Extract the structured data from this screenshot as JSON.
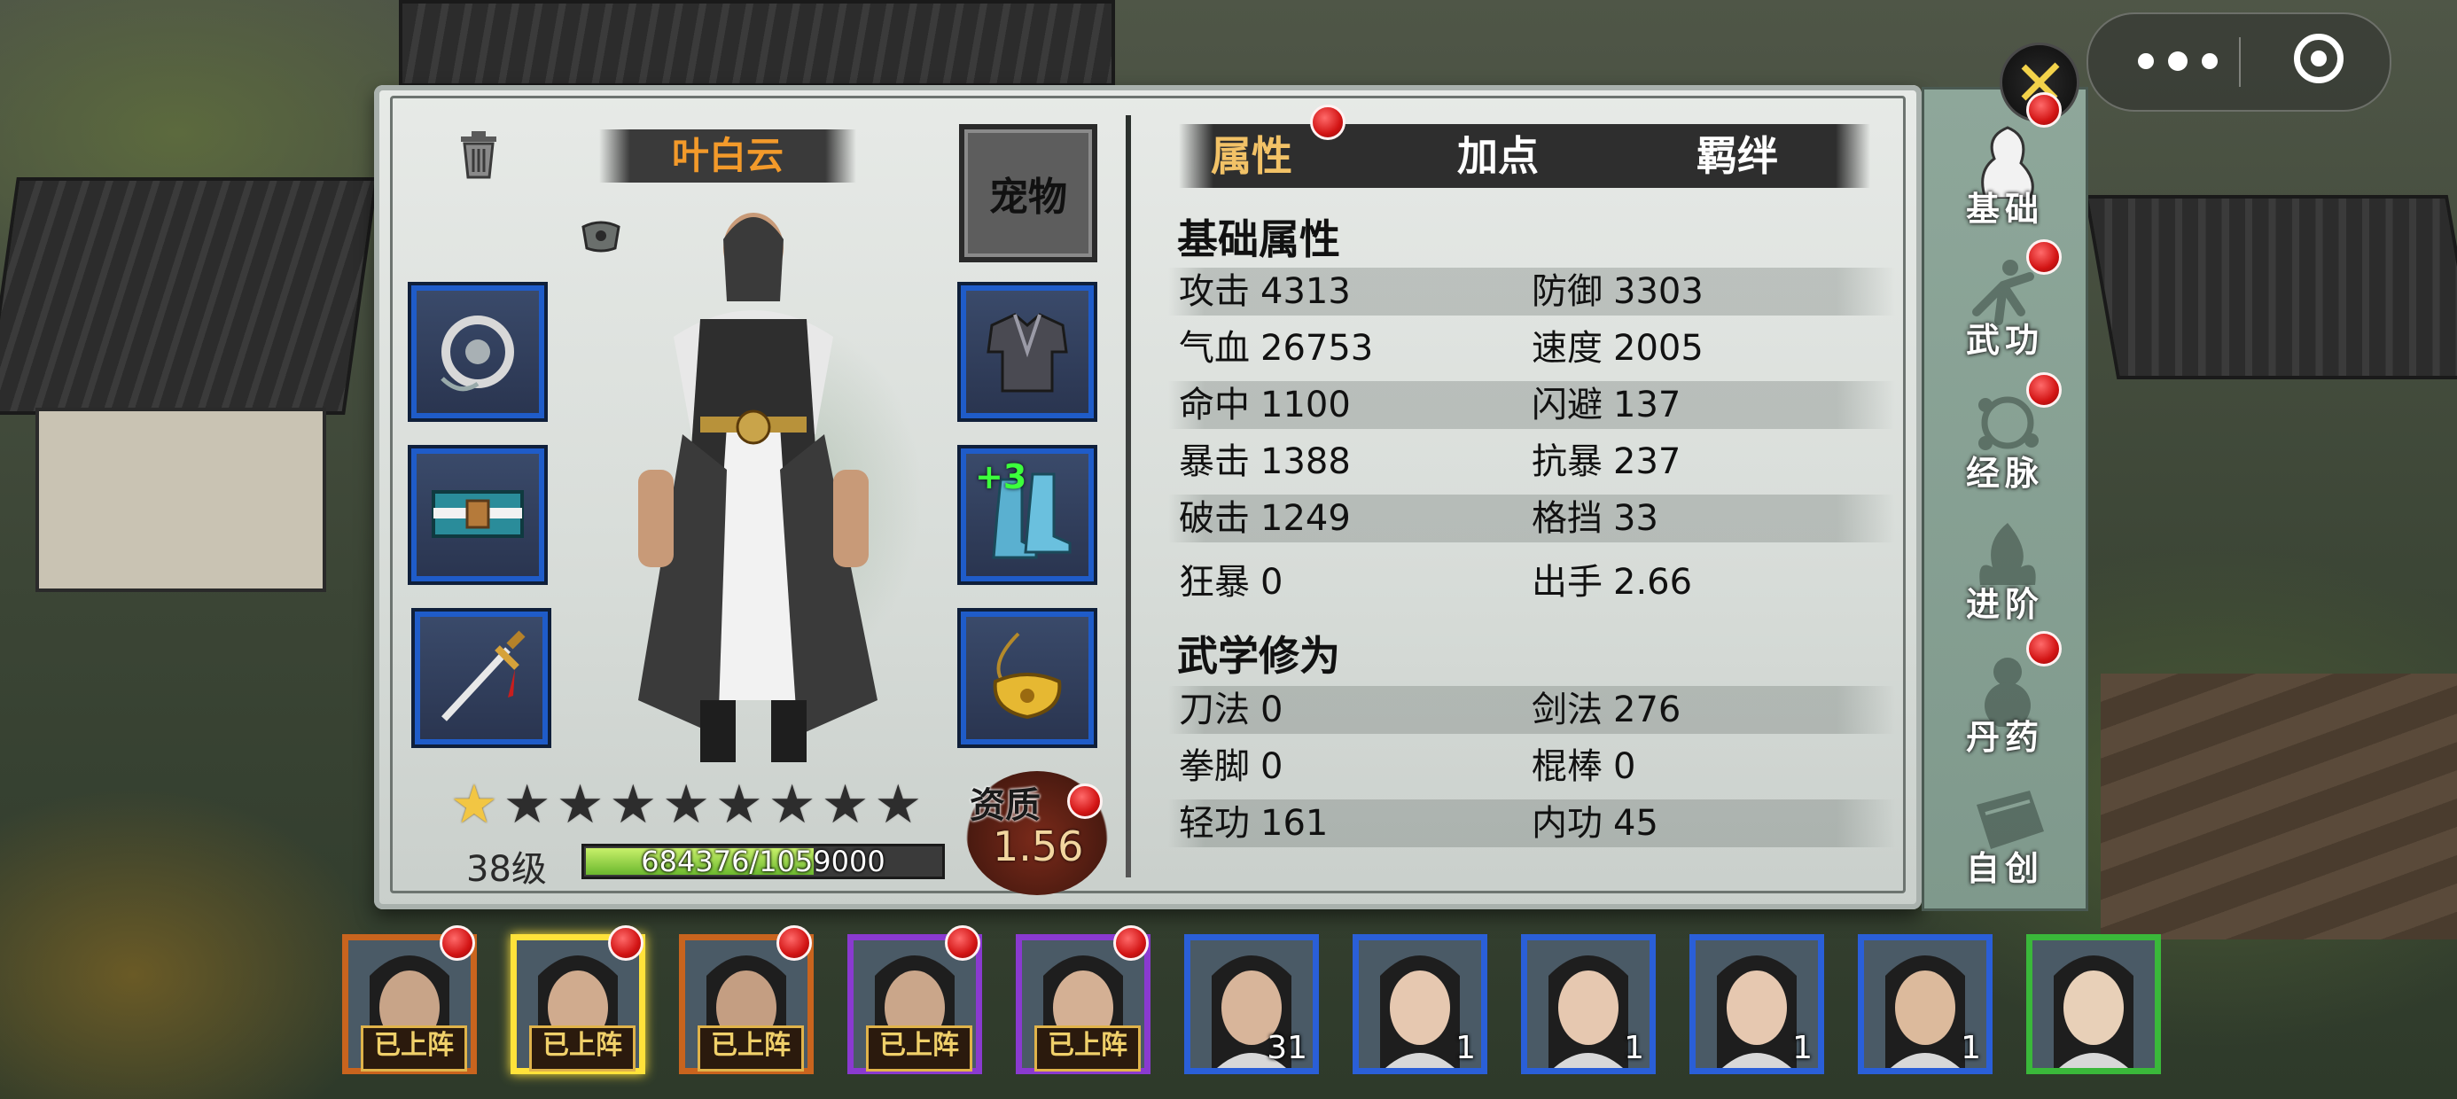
{
  "character": {
    "name": "叶白云",
    "level_label": "38级",
    "exp_text": "684376/1059000",
    "exp_progress": 0.646,
    "stars_total": 9,
    "stars_lit": 1,
    "aptitude_label": "资质",
    "aptitude_value": "1.56"
  },
  "pet_button": "宠物",
  "equipment": {
    "boots_enhance": "+3"
  },
  "tabs": [
    {
      "label": "属性",
      "active": true,
      "badge": true
    },
    {
      "label": "加点",
      "active": false,
      "badge": false
    },
    {
      "label": "羁绊",
      "active": false,
      "badge": false
    }
  ],
  "basic_attributes": {
    "title": "基础属性",
    "rows": [
      [
        {
          "label": "攻击",
          "value": "4313"
        },
        {
          "label": "防御",
          "value": "3303"
        }
      ],
      [
        {
          "label": "气血",
          "value": "26753"
        },
        {
          "label": "速度",
          "value": "2005"
        }
      ],
      [
        {
          "label": "命中",
          "value": "1100"
        },
        {
          "label": "闪避",
          "value": "137"
        }
      ],
      [
        {
          "label": "暴击",
          "value": "1388"
        },
        {
          "label": "抗暴",
          "value": "237"
        }
      ],
      [
        {
          "label": "破击",
          "value": "1249"
        },
        {
          "label": "格挡",
          "value": "33"
        }
      ],
      [
        {
          "label": "狂暴",
          "value": "0"
        },
        {
          "label": "出手",
          "value": "2.66"
        }
      ]
    ]
  },
  "martial_attributes": {
    "title": "武学修为",
    "rows": [
      [
        {
          "label": "刀法",
          "value": "0"
        },
        {
          "label": "剑法",
          "value": "276"
        }
      ],
      [
        {
          "label": "拳脚",
          "value": "0"
        },
        {
          "label": "棍棒",
          "value": "0"
        }
      ],
      [
        {
          "label": "轻功",
          "value": "161"
        },
        {
          "label": "内功",
          "value": "45"
        }
      ]
    ]
  },
  "side_nav": [
    {
      "label": "基础",
      "icon": "figure-icon",
      "active": true,
      "badge": true
    },
    {
      "label": "武功",
      "icon": "martial-pose-icon",
      "active": false,
      "badge": true
    },
    {
      "label": "经脉",
      "icon": "meridian-icon",
      "active": false,
      "badge": true
    },
    {
      "label": "进阶",
      "icon": "flame-icon",
      "active": false,
      "badge": false
    },
    {
      "label": "丹药",
      "icon": "gourd-icon",
      "active": false,
      "badge": true
    },
    {
      "label": "自创",
      "icon": "scroll-icon",
      "active": false,
      "badge": false
    }
  ],
  "roster": [
    {
      "tag": "已上阵",
      "count": "",
      "rarity": "orange",
      "selected": false,
      "badge": true
    },
    {
      "tag": "已上阵",
      "count": "",
      "rarity": "orange",
      "selected": true,
      "badge": true
    },
    {
      "tag": "已上阵",
      "count": "",
      "rarity": "orange",
      "selected": false,
      "badge": true
    },
    {
      "tag": "已上阵",
      "count": "",
      "rarity": "purple",
      "selected": false,
      "badge": true
    },
    {
      "tag": "已上阵",
      "count": "",
      "rarity": "purple",
      "selected": false,
      "badge": true
    },
    {
      "tag": "",
      "count": "31",
      "rarity": "blue",
      "selected": false,
      "badge": false
    },
    {
      "tag": "",
      "count": "1",
      "rarity": "blue",
      "selected": false,
      "badge": false
    },
    {
      "tag": "",
      "count": "1",
      "rarity": "blue",
      "selected": false,
      "badge": false
    },
    {
      "tag": "",
      "count": "1",
      "rarity": "blue",
      "selected": false,
      "badge": false
    },
    {
      "tag": "",
      "count": "1",
      "rarity": "blue",
      "selected": false,
      "badge": false
    },
    {
      "tag": "",
      "count": "",
      "rarity": "green",
      "selected": false,
      "badge": false
    }
  ],
  "colors": {
    "name_orange": "#f39a2a",
    "tab_active": "#f2c267",
    "slot_border": "#1f5cc9",
    "badge_red": "#d21414"
  }
}
